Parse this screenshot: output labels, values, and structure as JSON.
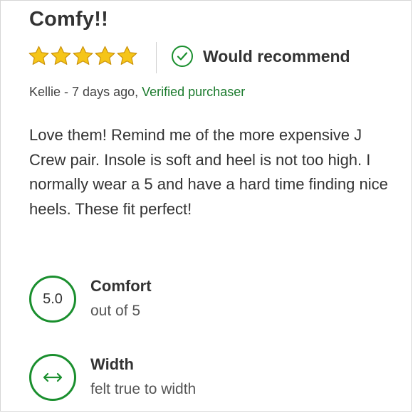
{
  "review": {
    "title": "Comfy!!",
    "rating": 5,
    "rating_max": 5,
    "recommend_label": "Would recommend",
    "author": "Kellie",
    "separator": " - ",
    "time_ago": "7 days ago,",
    "verified_label": "Verified purchaser",
    "body": "Love them! Remind me of the more expensive J Crew pair. Insole is soft and heel is not too high. I normally wear a 5 and have a hard time finding nice heels. These fit perfect!"
  },
  "metrics": {
    "comfort": {
      "value": "5.0",
      "title": "Comfort",
      "subtitle": "out of 5"
    },
    "width": {
      "icon": "left-right-arrow-icon",
      "title": "Width",
      "subtitle": "felt true to width"
    }
  },
  "colors": {
    "star": "#f5c518",
    "accent_green": "#1a8f2e",
    "verified_green": "#1a7a2c",
    "text": "#333333"
  }
}
